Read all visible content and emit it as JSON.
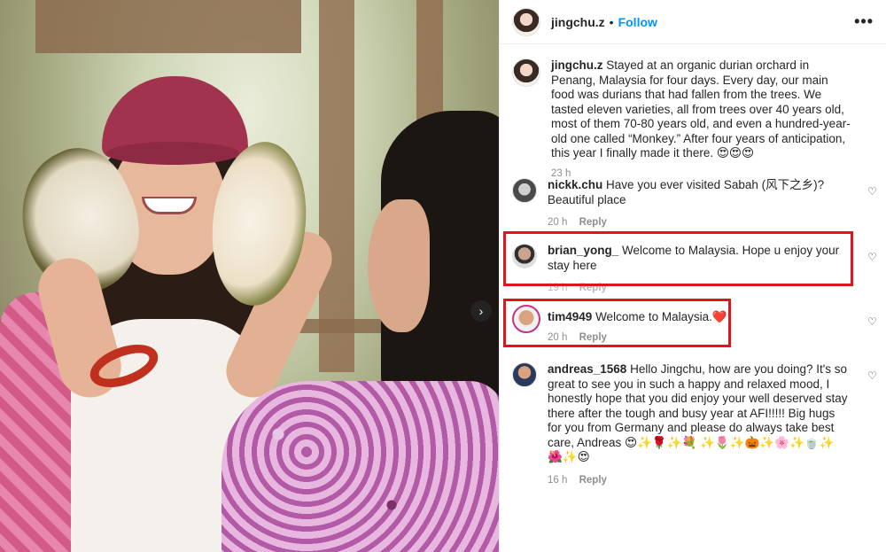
{
  "post": {
    "username": "jingchu.z",
    "separator": "•",
    "follow_label": "Follow",
    "more_icon": "more-horizontal-icon",
    "carousel_next_icon": "chevron-right-icon",
    "caption": {
      "username": "jingchu.z",
      "text": "Stayed at an organic durian orchard in Penang, Malaysia for four days. Every day, our main food was durians that had fallen from the trees. We tasted eleven varieties, all from trees over 40 years old, most of them 70-80 years old, and even a hundred-year-old one called “Monkey.” After four years of anticipation, this year I finally made it there. 😍😍😍",
      "time": "23 h"
    }
  },
  "comments": [
    {
      "username": "nickk.chu",
      "text": "Have you ever visited Sabah (风下之乡)? Beautiful place",
      "time": "20 h",
      "reply_label": "Reply"
    },
    {
      "username": "brian_yong_",
      "text": "Welcome to Malaysia. Hope u enjoy your stay here",
      "time": "19 h",
      "reply_label": "Reply"
    },
    {
      "username": "tim4949",
      "text": "Welcome to Malaysia.❤️",
      "time": "20 h",
      "reply_label": "Reply"
    },
    {
      "username": "andreas_1568",
      "text": "Hello Jingchu, how are you doing? It's so great to see you in such a happy and relaxed mood, I honestly hope that you did enjoy your well deserved stay there after the tough and busy year at AFI!!!!! Big hugs for you from Germany and please do always take best care, Andreas 😍✨🌹✨💐 ✨🌷✨🎃✨🌸✨🍵✨🌺✨😍",
      "time": "16 h",
      "reply_label": "Reply"
    }
  ],
  "colors": {
    "follow": "#0095f6",
    "highlight": "#e0141e",
    "meta": "#8e8e8e"
  }
}
